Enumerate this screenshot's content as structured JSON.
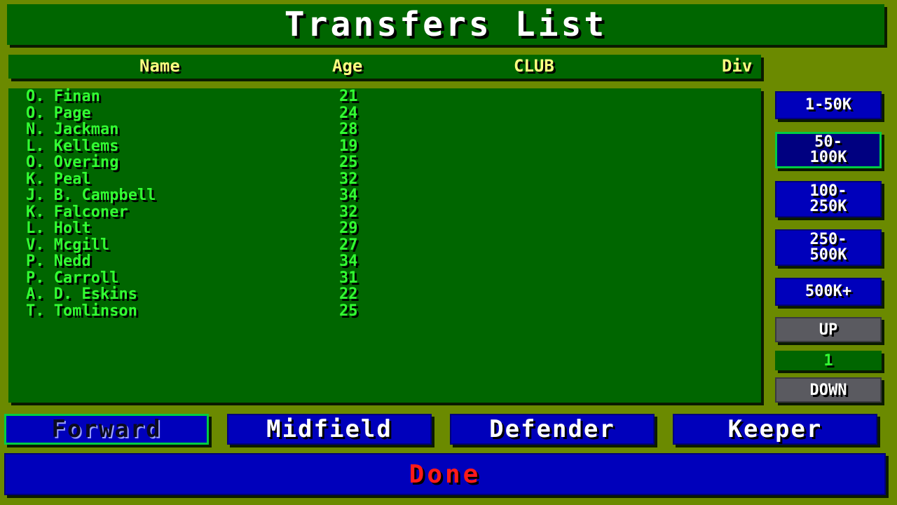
{
  "title": "Transfers List",
  "columns": {
    "name": "Name",
    "age": "Age",
    "club": "CLUB",
    "div": "Div"
  },
  "players": [
    {
      "name": "O. Finan",
      "age": "21"
    },
    {
      "name": "O. Page",
      "age": "24"
    },
    {
      "name": "N. Jackman",
      "age": "28"
    },
    {
      "name": "L. Kellems",
      "age": "19"
    },
    {
      "name": "O. Overing",
      "age": "25"
    },
    {
      "name": "K. Peal",
      "age": "32"
    },
    {
      "name": "J. B. Campbell",
      "age": "34"
    },
    {
      "name": "K. Falconer",
      "age": "32"
    },
    {
      "name": "L. Holt",
      "age": "29"
    },
    {
      "name": "V. Mcgill",
      "age": "27"
    },
    {
      "name": "P. Nedd",
      "age": "34"
    },
    {
      "name": "P. Carroll",
      "age": "31"
    },
    {
      "name": "A. D. Eskins",
      "age": "22"
    },
    {
      "name": "T. Tomlinson",
      "age": "25"
    }
  ],
  "price_filters": {
    "f1": "1-50K",
    "f2_line1": "50-",
    "f2_line2": "100K",
    "f3_line1": "100-",
    "f3_line2": "250K",
    "f4_line1": "250-",
    "f4_line2": "500K",
    "f5": "500K+",
    "selected": "50-100K"
  },
  "pager": {
    "up": "UP",
    "page": "1",
    "down": "DOWN"
  },
  "positions": {
    "forward": "Forward",
    "midfield": "Midfield",
    "defender": "Defender",
    "keeper": "Keeper",
    "selected": "Forward"
  },
  "done": "Done",
  "colors": {
    "background": "#6b8a00",
    "panel": "#006600",
    "button": "#0000bb",
    "text_green": "#33ff33",
    "header_yellow": "#ffff80",
    "done_red": "#ff1a1a"
  }
}
